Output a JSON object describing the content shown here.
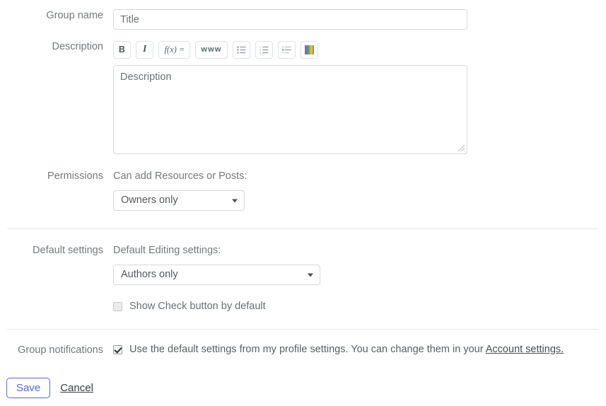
{
  "form": {
    "group_name": {
      "label": "Group name",
      "value": "",
      "placeholder": "Title"
    },
    "description": {
      "label": "Description",
      "value": "",
      "placeholder": "Description",
      "toolbar": [
        {
          "name": "bold-button",
          "glyph": "B"
        },
        {
          "name": "italic-button",
          "glyph": "I"
        },
        {
          "name": "formula-button",
          "glyph": "f(x) ="
        },
        {
          "name": "link-button",
          "glyph": "www"
        },
        {
          "name": "bulleted-list-button",
          "glyph": "bulleted-list-icon"
        },
        {
          "name": "numbered-list-button",
          "glyph": "numbered-list-icon"
        },
        {
          "name": "indent-list-button",
          "glyph": "indent-list-icon"
        },
        {
          "name": "color-button",
          "glyph": "color-palette-icon"
        }
      ]
    },
    "permissions": {
      "label": "Permissions",
      "sub_label": "Can add Resources or Posts:",
      "selected": "Owners only"
    },
    "default_settings": {
      "label": "Default settings",
      "sub_label": "Default Editing settings:",
      "selected": "Authors only",
      "checkbox_label": "Show Check button by default",
      "checkbox_checked": false
    },
    "notifications": {
      "label": "Group notifications",
      "checked": true,
      "text": "Use the default settings from my profile settings. You can change them in your ",
      "link_text": "Account settings.",
      "link_name": "account-settings-link"
    },
    "footer": {
      "save_label": "Save",
      "cancel_label": "Cancel"
    }
  },
  "colors": {
    "accent": "#5b64ea",
    "label": "#75797c",
    "border": "#d6d9dc",
    "divider": "#e3e5e7"
  }
}
